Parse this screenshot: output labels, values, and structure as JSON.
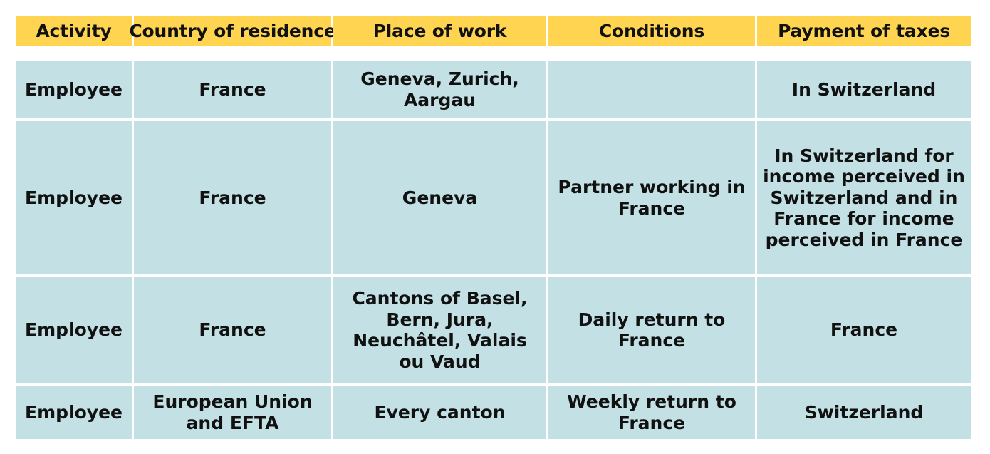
{
  "table": {
    "columns": [
      {
        "key": "activity",
        "label": "Activity"
      },
      {
        "key": "country",
        "label": "Country of residence"
      },
      {
        "key": "place",
        "label": "Place of work"
      },
      {
        "key": "conditions",
        "label": "Conditions"
      },
      {
        "key": "taxes",
        "label": "Payment of taxes"
      }
    ],
    "rows": [
      {
        "activity": "Employee",
        "country": "France",
        "place": "Geneva, Zurich, Aargau",
        "conditions": "",
        "taxes": "In Switzerland"
      },
      {
        "activity": "Employee",
        "country": "France",
        "place": "Geneva",
        "conditions": "Partner working in France",
        "taxes": "In Switzerland for income perceived in Switzerland and in France for income perceived in France"
      },
      {
        "activity": "Employee",
        "country": "France",
        "place": "Cantons of Basel, Bern, Jura, Neuchâtel, Valais ou Vaud",
        "conditions": "Daily return to France",
        "taxes": "France"
      },
      {
        "activity": "Employee",
        "country": "European Union and EFTA",
        "place": "Every canton",
        "conditions": "Weekly return to France",
        "taxes": "Switzerland"
      }
    ]
  },
  "colors": {
    "header_background": "#FFD451",
    "cell_background": "#C3E1E4",
    "text": "#111111",
    "page_background": "#FFFFFF"
  }
}
